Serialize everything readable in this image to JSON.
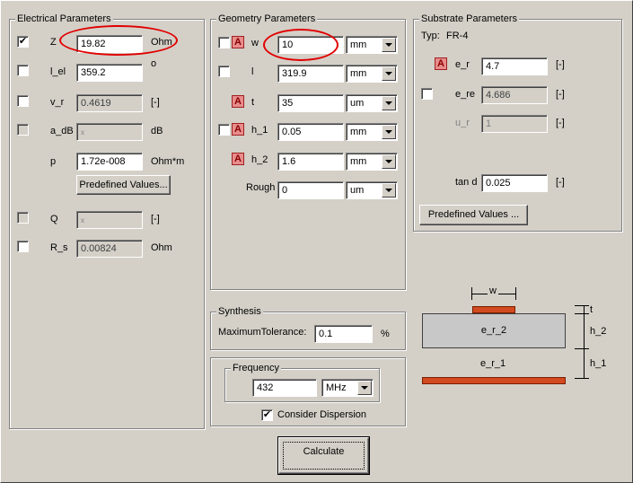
{
  "electrical": {
    "title": "Electrical Parameters",
    "z": {
      "label": "Z",
      "value": "19.82",
      "unit": "Ohm",
      "checked": "✔"
    },
    "l_el": {
      "label": "l_el",
      "value": "359.2",
      "unit": "o"
    },
    "v_r": {
      "label": "v_r",
      "value": "0.4619",
      "unit": "[-]"
    },
    "a_db": {
      "label": "a_dB",
      "value": "x",
      "unit": "dB"
    },
    "p": {
      "label": "p",
      "value": "1.72e-008",
      "unit": "Ohm*m"
    },
    "predefined": "Predefined Values...",
    "q": {
      "label": "Q",
      "value": "x",
      "unit": "[-]"
    },
    "r_s": {
      "label": "R_s",
      "value": "0.00824",
      "unit": "Ohm"
    }
  },
  "geometry": {
    "title": "Geometry Parameters",
    "lock_glyph": "A",
    "w": {
      "label": "w",
      "value": "10",
      "unit": "mm"
    },
    "l": {
      "label": "l",
      "value": "319.9",
      "unit": "mm"
    },
    "t": {
      "label": "t",
      "value": "35",
      "unit": "um"
    },
    "h_1": {
      "label": "h_1",
      "value": "0.05",
      "unit": "mm"
    },
    "h_2": {
      "label": "h_2",
      "value": "1.6",
      "unit": "mm"
    },
    "rough": {
      "label": "Rough",
      "value": "0",
      "unit": "um"
    }
  },
  "substrate": {
    "title": "Substrate Parameters",
    "typ_label": "Typ:",
    "typ_value": "FR-4",
    "e_r": {
      "label": "e_r",
      "value": "4.7",
      "unit": "[-]"
    },
    "e_re": {
      "label": "e_re",
      "value": "4.686",
      "unit": "[-]"
    },
    "u_r": {
      "label": "u_r",
      "value": "1",
      "unit": "[-]"
    },
    "tand": {
      "label": "tan d",
      "value": "0.025",
      "unit": "[-]"
    },
    "predefined": "Predefined Values ..."
  },
  "synthesis": {
    "title": "Synthesis",
    "tol_label": "MaximumTolerance:",
    "tol_value": "0.1",
    "tol_unit": "%"
  },
  "frequency": {
    "title": "Frequency",
    "value": "432",
    "unit": "MHz",
    "dispersion_label": "Consider Dispersion",
    "dispersion_checked": "✔"
  },
  "calculate": "Calculate",
  "diagram": {
    "w": "w",
    "t": "t",
    "er2": "e_r_2",
    "h2": "h_2",
    "er1": "e_r_1",
    "h1": "h_1"
  },
  "colors": {
    "highlight_ellipse": "#e00000",
    "conductor": "#d24a1f",
    "lock_icon": "#e88c8c"
  }
}
